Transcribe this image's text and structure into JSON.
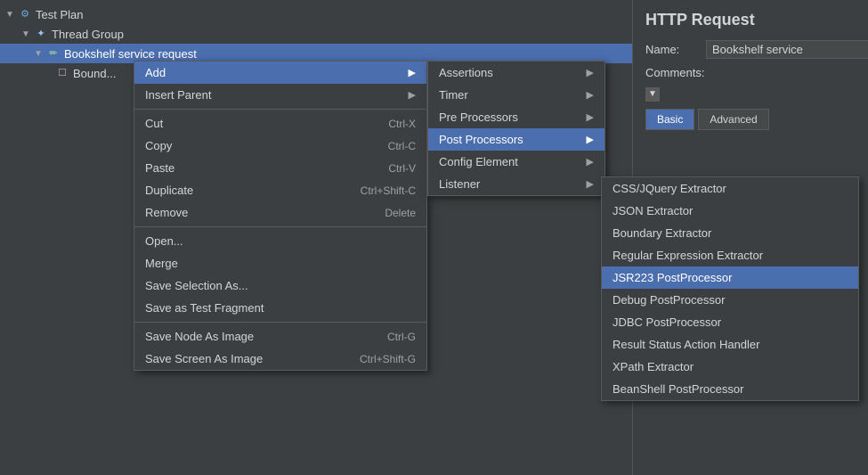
{
  "tree": {
    "items": [
      {
        "label": "Test Plan",
        "indent": 0,
        "arrow": "▼",
        "iconType": "gear"
      },
      {
        "label": "Thread Group",
        "indent": 1,
        "arrow": "▼",
        "iconType": "thread"
      },
      {
        "label": "Bookshelf service request",
        "indent": 2,
        "arrow": "▼",
        "iconType": "req",
        "selected": true
      },
      {
        "label": "Bound...",
        "indent": 3,
        "arrow": "",
        "iconType": "box"
      }
    ]
  },
  "ctx_menu_1": {
    "items": [
      {
        "label": "Add",
        "shortcut": "",
        "arrow": "▶",
        "type": "item",
        "active": false
      },
      {
        "label": "Insert Parent",
        "shortcut": "",
        "arrow": "▶",
        "type": "item",
        "active": false
      },
      {
        "type": "separator"
      },
      {
        "label": "Cut",
        "shortcut": "Ctrl-X",
        "type": "item"
      },
      {
        "label": "Copy",
        "shortcut": "Ctrl-C",
        "type": "item"
      },
      {
        "label": "Paste",
        "shortcut": "Ctrl-V",
        "type": "item"
      },
      {
        "label": "Duplicate",
        "shortcut": "Ctrl+Shift-C",
        "type": "item"
      },
      {
        "label": "Remove",
        "shortcut": "Delete",
        "type": "item"
      },
      {
        "type": "separator"
      },
      {
        "label": "Open...",
        "shortcut": "",
        "type": "item"
      },
      {
        "label": "Merge",
        "shortcut": "",
        "type": "item"
      },
      {
        "label": "Save Selection As...",
        "shortcut": "",
        "type": "item"
      },
      {
        "label": "Save as Test Fragment",
        "shortcut": "",
        "type": "item"
      },
      {
        "type": "separator"
      },
      {
        "label": "Save Node As Image",
        "shortcut": "Ctrl-G",
        "type": "item"
      },
      {
        "label": "Save Screen As Image",
        "shortcut": "Ctrl+Shift-G",
        "type": "item"
      }
    ]
  },
  "submenu_2": {
    "items": [
      {
        "label": "Assertions",
        "arrow": "▶",
        "active": false
      },
      {
        "label": "Timer",
        "arrow": "▶",
        "active": false
      },
      {
        "label": "Pre Processors",
        "arrow": "▶",
        "active": false
      },
      {
        "label": "Post Processors",
        "arrow": "▶",
        "active": true
      },
      {
        "label": "Config Element",
        "arrow": "▶",
        "active": false
      },
      {
        "label": "Listener",
        "arrow": "▶",
        "active": false
      }
    ]
  },
  "submenu_3": {
    "items": [
      {
        "label": "CSS/JQuery Extractor",
        "active": false
      },
      {
        "label": "JSON Extractor",
        "active": false
      },
      {
        "label": "Boundary Extractor",
        "active": false
      },
      {
        "label": "Regular Expression Extractor",
        "active": false
      },
      {
        "label": "JSR223 PostProcessor",
        "active": true
      },
      {
        "label": "Debug PostProcessor",
        "active": false
      },
      {
        "label": "JDBC PostProcessor",
        "active": false
      },
      {
        "label": "Result Status Action Handler",
        "active": false
      },
      {
        "label": "XPath Extractor",
        "active": false
      },
      {
        "label": "BeanShell PostProcessor",
        "active": false
      }
    ]
  },
  "http_panel": {
    "title": "HTTP Request",
    "name_label": "Name:",
    "name_value": "Bookshelf service",
    "comments_label": "Comments:",
    "tab_basic": "Basic",
    "tab_advanced": "Advanced"
  }
}
